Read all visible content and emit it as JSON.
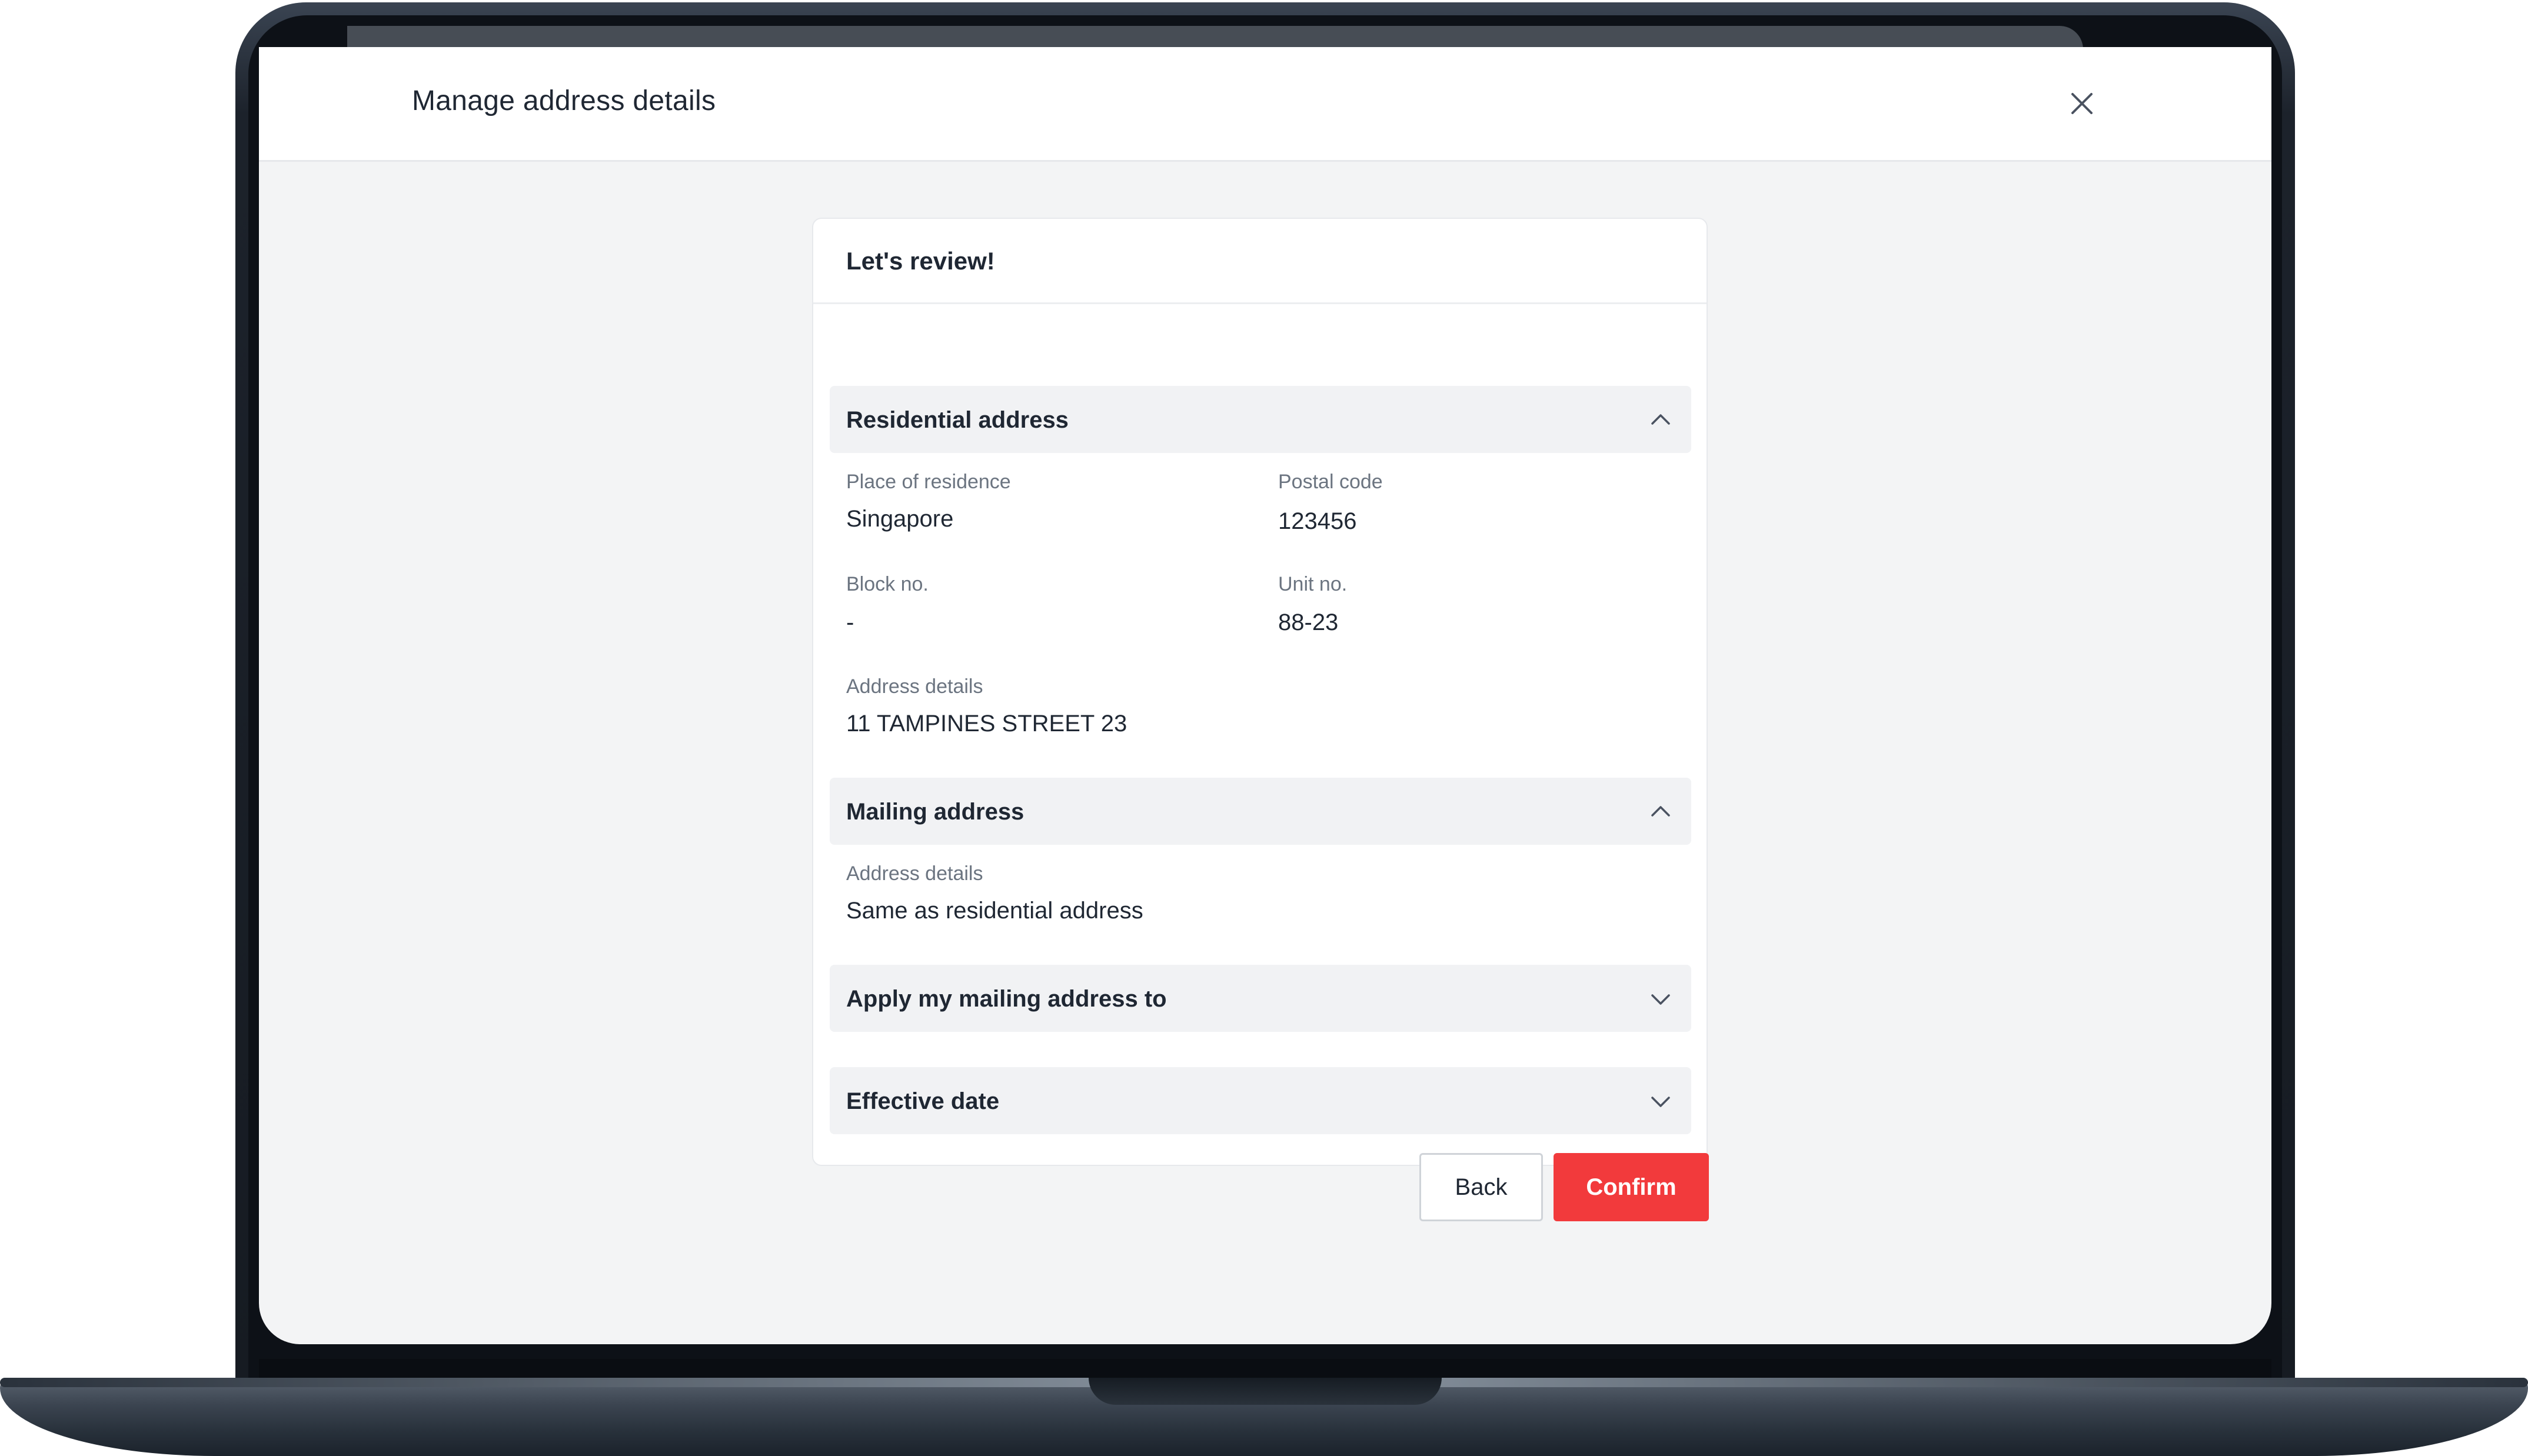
{
  "modal": {
    "title": "Manage address details"
  },
  "review": {
    "heading": "Let's review!",
    "residential": {
      "header": "Residential address",
      "expanded": true,
      "fields": {
        "place_label": "Place of residence",
        "place_value": "Singapore",
        "postal_label": "Postal code",
        "postal_value": "123456",
        "block_label": "Block no.",
        "block_value": "-",
        "unit_label": "Unit no.",
        "unit_value": "88-23",
        "address_label": "Address details",
        "address_value": "11 TAMPINES STREET 23"
      }
    },
    "mailing": {
      "header": "Mailing address",
      "expanded": true,
      "address_label": "Address details",
      "address_value": "Same as residential address"
    },
    "apply": {
      "header": "Apply my mailing address to",
      "expanded": false
    },
    "effective": {
      "header": "Effective date",
      "expanded": false
    }
  },
  "actions": {
    "back_label": "Back",
    "confirm_label": "Confirm"
  },
  "icons": {
    "close": "close-icon",
    "expanded": "chevron-up-icon",
    "collapsed": "chevron-down-icon"
  },
  "colors": {
    "confirm": "#f23a3c",
    "section_bg": "#f1f2f4",
    "text": "#1f2733",
    "muted": "#6b7480",
    "frame": "#161b22"
  }
}
